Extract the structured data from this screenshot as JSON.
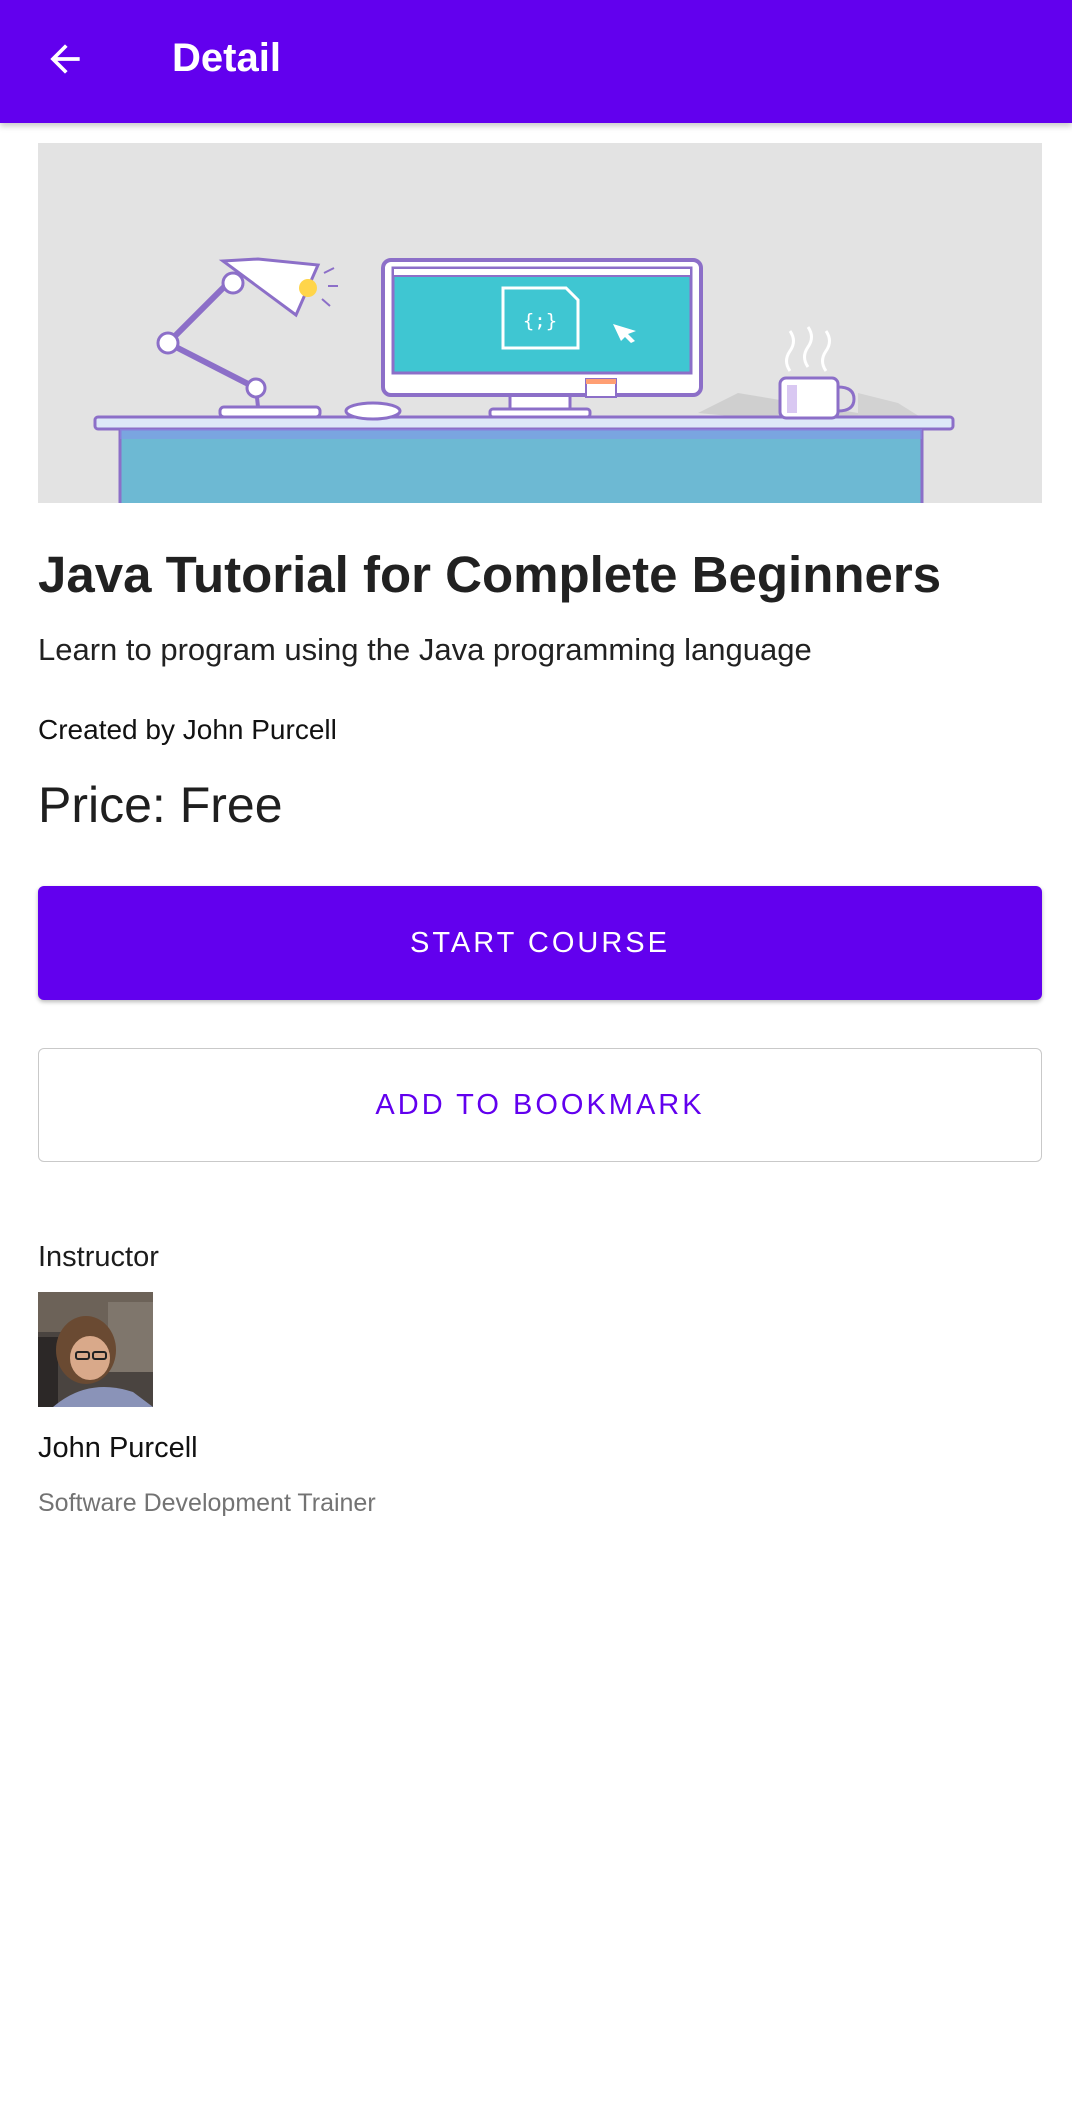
{
  "app_bar": {
    "title": "Detail",
    "background_color": "#6200ee",
    "back_icon": "arrow-back-icon"
  },
  "hero": {
    "icon": "code-file-icon",
    "code_glyph": "{;}"
  },
  "course": {
    "title": "Java Tutorial for Complete Beginners",
    "subtitle": "Learn to program using the Java programming language",
    "created_by": "Created by John Purcell",
    "price": "Price: Free"
  },
  "actions": {
    "start_label": "START COURSE",
    "bookmark_label": "ADD TO BOOKMARK",
    "accent_color": "#6200ee"
  },
  "instructor": {
    "heading": "Instructor",
    "name": "John Purcell",
    "role": "Software Development Trainer"
  }
}
